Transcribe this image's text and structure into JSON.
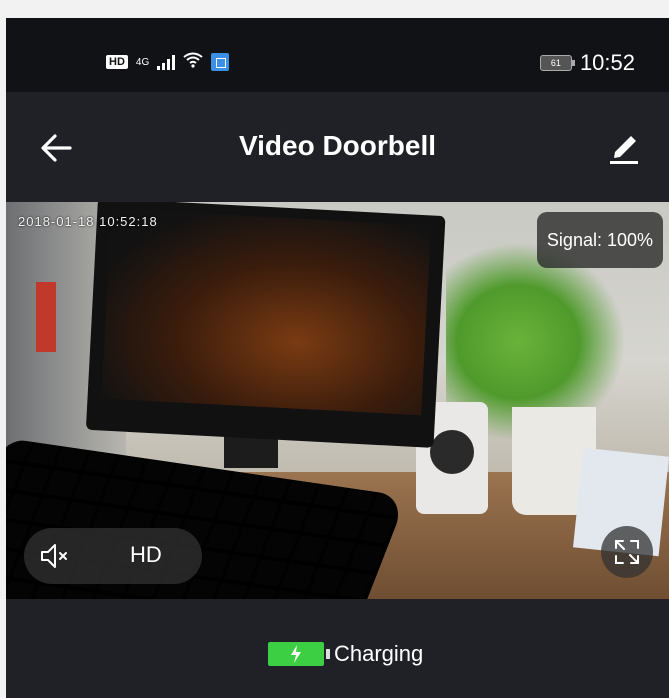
{
  "statusbar": {
    "hd_badge": "HD",
    "network": "4G",
    "battery_level": "61",
    "time": "10:52",
    "icons": [
      "hd-icon",
      "cellular-signal-icon",
      "wifi-icon",
      "app-notification-icon",
      "battery-icon"
    ]
  },
  "header": {
    "title": "Video Doorbell",
    "back_icon": "arrow-left-icon",
    "edit_icon": "pencil-icon"
  },
  "video": {
    "timestamp": "2018-01-18 10:52:18",
    "signal_label": "Signal: 100%",
    "quality_label": "HD",
    "mute_icon": "speaker-muted-icon",
    "fullscreen_icon": "expand-icon"
  },
  "footer": {
    "status_label": "Charging",
    "battery_icon": "battery-charging-icon",
    "battery_color": "#3ccf43"
  },
  "colors": {
    "header_bg": "#1f2127",
    "statusbar_bg": "#111215",
    "accent_blue": "#3b8fe6"
  }
}
